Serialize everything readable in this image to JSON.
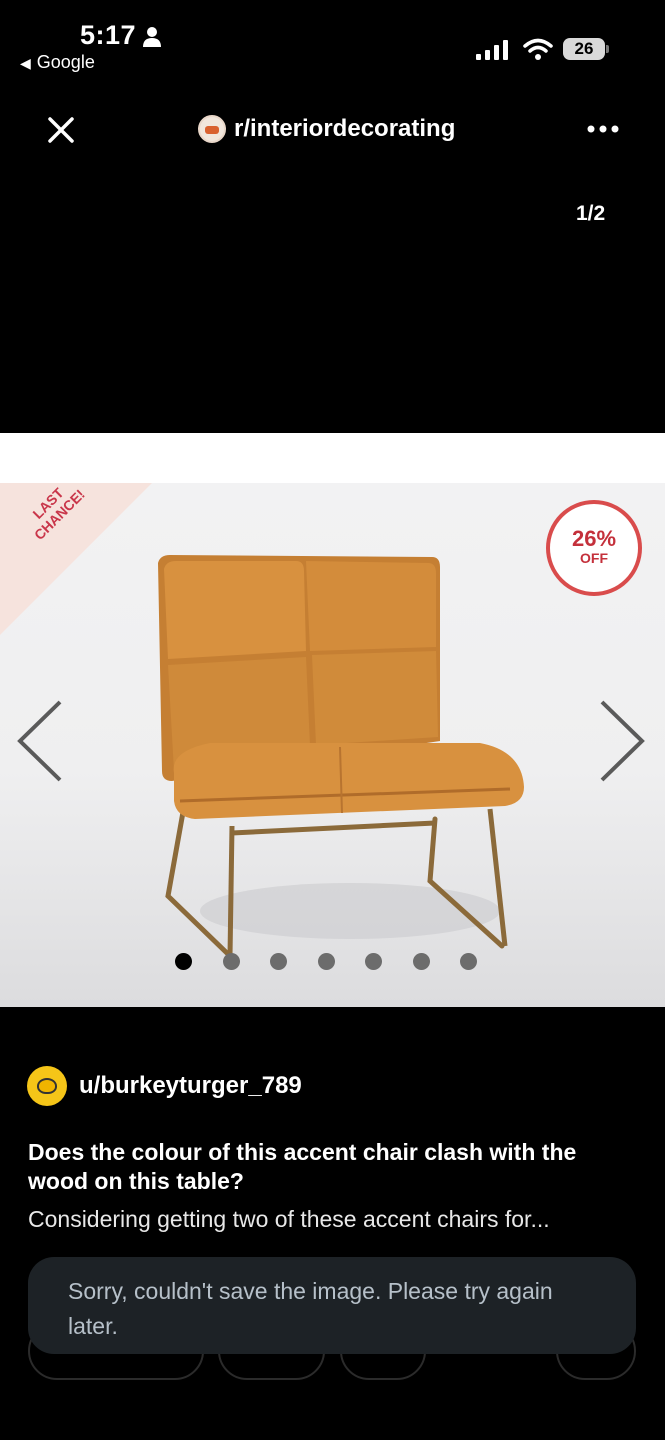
{
  "status_bar": {
    "time": "5:17",
    "back_app": "Google",
    "battery": "26",
    "icons": [
      "person-icon",
      "signal-icon",
      "wifi-icon",
      "battery-icon"
    ]
  },
  "header": {
    "subreddit": "r/interiordecorating",
    "page_indicator": "1/2",
    "icons": [
      "close-icon",
      "more-icon"
    ]
  },
  "product_image": {
    "ribbon_line1": "LAST",
    "ribbon_line2": "CHANCE!",
    "discount_pct": "26%",
    "discount_off": "OFF",
    "carousel_total": 7,
    "carousel_active": 1,
    "colors": {
      "chair": "#d08b3a",
      "legs": "#8b6a3a",
      "badge": "#d94c4c"
    }
  },
  "post": {
    "username": "u/burkeyturger_789",
    "title": "Does the colour of this accent chair clash with the wood on this table?",
    "body": "Considering getting two of these accent chairs for..."
  },
  "toast": {
    "message": "Sorry, couldn't save the image. Please try again later."
  }
}
